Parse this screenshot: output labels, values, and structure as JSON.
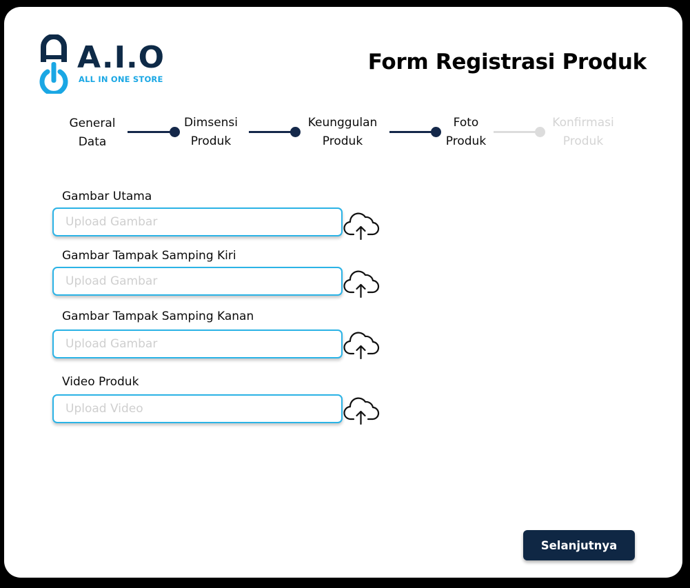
{
  "brand": {
    "name": "A.I.O",
    "tagline": "ALL IN ONE STORE",
    "primary_color": "#0e2a47",
    "accent_color": "#1aa7e4",
    "logo_icon": "power-lock-icon"
  },
  "header": {
    "title": "Form Registrasi Produk"
  },
  "stepper": {
    "steps": [
      {
        "line1": "General",
        "line2": "Data",
        "state": "done"
      },
      {
        "line1": "Dimsensi",
        "line2": "Produk",
        "state": "done"
      },
      {
        "line1": "Keunggulan",
        "line2": "Produk",
        "state": "done"
      },
      {
        "line1": "Foto",
        "line2": "Produk",
        "state": "active"
      },
      {
        "line1": "Konfirmasi",
        "line2": "Produk",
        "state": "pending"
      }
    ],
    "active_color": "#14284a",
    "inactive_color": "#dcdcdc"
  },
  "form": {
    "fields": [
      {
        "label": "Gambar Utama",
        "placeholder": "Upload Gambar",
        "value": "",
        "icon": "cloud-upload-icon"
      },
      {
        "label": "Gambar Tampak Samping Kiri",
        "placeholder": "Upload Gambar",
        "value": "",
        "icon": "cloud-upload-icon"
      },
      {
        "label": "Gambar Tampak Samping Kanan",
        "placeholder": "Upload Gambar",
        "value": "",
        "icon": "cloud-upload-icon"
      },
      {
        "label": "Video Produk",
        "placeholder": "Upload Video",
        "value": "",
        "icon": "cloud-upload-icon"
      }
    ],
    "input_border_color": "#2bb3e6"
  },
  "actions": {
    "next_label": "Selanjutnya",
    "button_color": "#0f2744"
  }
}
